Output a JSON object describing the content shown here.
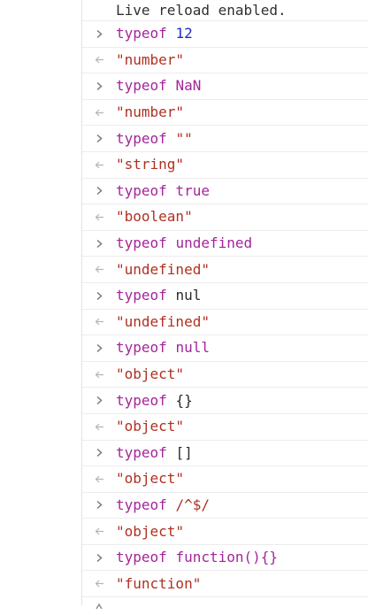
{
  "console": {
    "info_message": "Live reload enabled.",
    "entries": [
      {
        "keyword": "typeof",
        "operand": "12",
        "operand_kind": "number",
        "result": "\"number\""
      },
      {
        "keyword": "typeof",
        "operand": "NaN",
        "operand_kind": "keyword",
        "result": "\"number\""
      },
      {
        "keyword": "typeof",
        "operand": "\"\"",
        "operand_kind": "string",
        "result": "\"string\""
      },
      {
        "keyword": "typeof",
        "operand": "true",
        "operand_kind": "keyword",
        "result": "\"boolean\""
      },
      {
        "keyword": "typeof",
        "operand": "undefined",
        "operand_kind": "keyword",
        "result": "\"undefined\""
      },
      {
        "keyword": "typeof",
        "operand": "nul",
        "operand_kind": "plain",
        "result": "\"undefined\""
      },
      {
        "keyword": "typeof",
        "operand": "null",
        "operand_kind": "keyword",
        "result": "\"object\""
      },
      {
        "keyword": "typeof",
        "operand": "{}",
        "operand_kind": "plain",
        "result": "\"object\""
      },
      {
        "keyword": "typeof",
        "operand": "[]",
        "operand_kind": "plain",
        "result": "\"object\""
      },
      {
        "keyword": "typeof",
        "operand": "/^$/",
        "operand_kind": "string",
        "result": "\"object\""
      },
      {
        "keyword": "typeof",
        "operand": "function(){}",
        "operand_kind": "keyword",
        "result": "\"function\""
      }
    ],
    "icons": {
      "input_prompt": "chevron-right-icon",
      "result_marker": "left-arrow-icon",
      "input_caret": "prompt-caret-icon"
    },
    "colors": {
      "keyword": "#a3259b",
      "number": "#1d2bc9",
      "string": "#b03020",
      "plain": "#2b2b2b",
      "gutter": "#8a8a8a"
    }
  }
}
